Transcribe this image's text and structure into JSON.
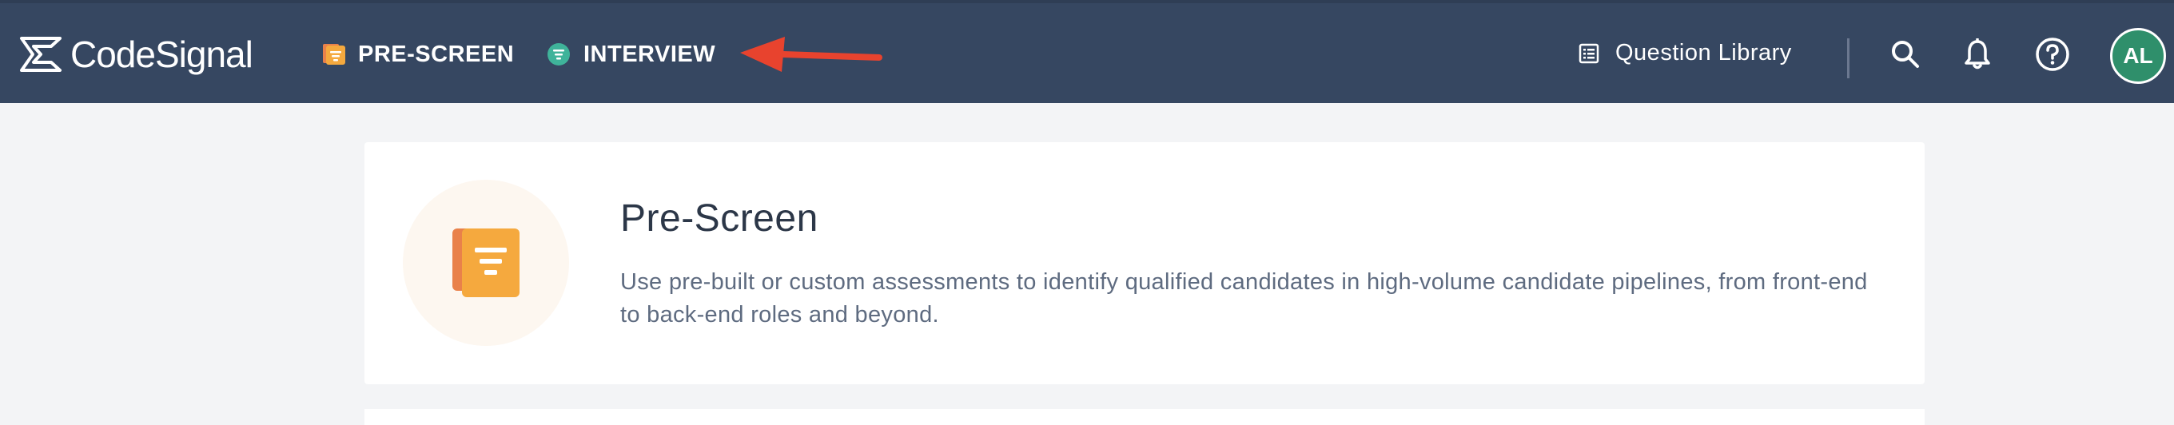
{
  "header": {
    "brand": "CodeSignal",
    "nav": {
      "prescreen_label": "PRE-SCREEN",
      "interview_label": "INTERVIEW"
    },
    "question_library_label": "Question Library",
    "avatar_initials": "AL"
  },
  "icons": {
    "logo": "codesignal-logo-icon",
    "prescreen": "prescreen-icon",
    "interview": "interview-icon",
    "arrow": "red-arrow-annotation",
    "library": "list-icon",
    "search": "search-icon",
    "notifications": "bell-icon",
    "help": "help-icon"
  },
  "main": {
    "card": {
      "title": "Pre-Screen",
      "description": "Use pre-built or custom assessments to identify qualified candidates in high-volume candidate pipelines, from front-end to back-end roles and beyond."
    }
  },
  "colors": {
    "header_bg": "#364761",
    "page_bg": "#f3f4f6",
    "accent_orange": "#f5a93e",
    "accent_teal": "#3fb39a",
    "avatar_green": "#2f8f6b",
    "annotation_red": "#e8432e"
  }
}
